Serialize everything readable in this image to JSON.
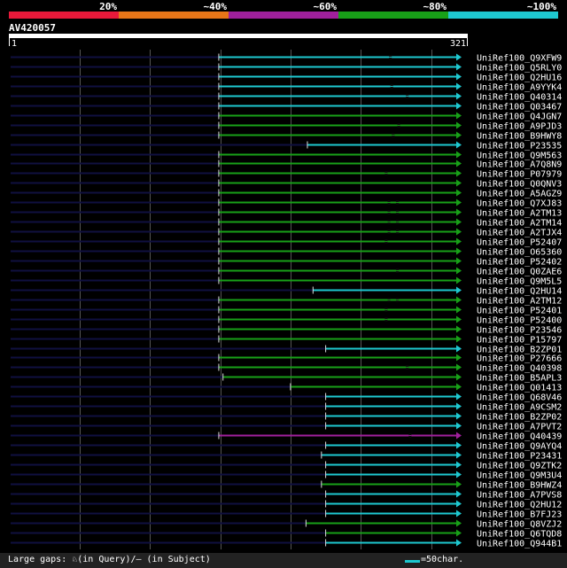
{
  "legend": {
    "labels": [
      "20%",
      "~40%",
      "~60%",
      "~80%",
      "~100%"
    ],
    "colors": [
      "#e8193a",
      "#e87618",
      "#a0209c",
      "#18a018",
      "#1ec8d0"
    ]
  },
  "query": {
    "id": "AV420057",
    "start": "1",
    "end": "321"
  },
  "footer": {
    "gaps_text": "Large gaps: ♘(in Query)/– (in Subject)",
    "scale_text": "=50char."
  },
  "chart_data": {
    "type": "alignment",
    "query_length": 321,
    "hits": [
      {
        "id": "UniRef100_Q9XFW9",
        "start": 149,
        "end": 321,
        "identity": "~100%",
        "gaps": [
          271
        ]
      },
      {
        "id": "UniRef100_Q5RLY0",
        "start": 149,
        "end": 321,
        "identity": "~100%",
        "gaps": []
      },
      {
        "id": "UniRef100_Q2HU16",
        "start": 149,
        "end": 321,
        "identity": "~100%",
        "gaps": []
      },
      {
        "id": "UniRef100_A9YYK4",
        "start": 149,
        "end": 321,
        "identity": "~100%",
        "gaps": [
          272
        ]
      },
      {
        "id": "UniRef100_Q40314",
        "start": 149,
        "end": 321,
        "identity": "~100%",
        "gaps": [
          283
        ]
      },
      {
        "id": "UniRef100_Q03467",
        "start": 149,
        "end": 321,
        "identity": "~100%",
        "gaps": []
      },
      {
        "id": "UniRef100_Q4JGN7",
        "start": 149,
        "end": 321,
        "identity": "~80%",
        "gaps": []
      },
      {
        "id": "UniRef100_A9PJD3",
        "start": 149,
        "end": 321,
        "identity": "~80%",
        "gaps": [
          277
        ]
      },
      {
        "id": "UniRef100_B9HWY8",
        "start": 149,
        "end": 321,
        "identity": "~80%",
        "gaps": [
          273
        ]
      },
      {
        "id": "UniRef100_P23535",
        "start": 212,
        "end": 321,
        "identity": "~100%",
        "gaps": []
      },
      {
        "id": "UniRef100_Q9M563",
        "start": 149,
        "end": 321,
        "identity": "~80%",
        "gaps": []
      },
      {
        "id": "UniRef100_A7Q8N9",
        "start": 149,
        "end": 321,
        "identity": "~80%",
        "gaps": []
      },
      {
        "id": "UniRef100_P07979",
        "start": 149,
        "end": 321,
        "identity": "~80%",
        "gaps": [
          268
        ]
      },
      {
        "id": "UniRef100_Q0QNV3",
        "start": 149,
        "end": 321,
        "identity": "~80%",
        "gaps": []
      },
      {
        "id": "UniRef100_A5AGZ9",
        "start": 149,
        "end": 321,
        "identity": "~80%",
        "gaps": []
      },
      {
        "id": "UniRef100_Q7XJ83",
        "start": 149,
        "end": 321,
        "identity": "~80%",
        "gaps": [
          270,
          276
        ]
      },
      {
        "id": "UniRef100_A2TM13",
        "start": 149,
        "end": 321,
        "identity": "~80%",
        "gaps": [
          270,
          276
        ]
      },
      {
        "id": "UniRef100_A2TM14",
        "start": 149,
        "end": 321,
        "identity": "~80%",
        "gaps": [
          270,
          276
        ]
      },
      {
        "id": "UniRef100_A2TJX4",
        "start": 149,
        "end": 321,
        "identity": "~80%",
        "gaps": [
          270,
          276
        ]
      },
      {
        "id": "UniRef100_P52407",
        "start": 149,
        "end": 321,
        "identity": "~80%",
        "gaps": [
          268
        ]
      },
      {
        "id": "UniRef100_O65360",
        "start": 149,
        "end": 321,
        "identity": "~80%",
        "gaps": []
      },
      {
        "id": "UniRef100_P52402",
        "start": 149,
        "end": 321,
        "identity": "~80%",
        "gaps": []
      },
      {
        "id": "UniRef100_Q0ZAE6",
        "start": 149,
        "end": 321,
        "identity": "~80%",
        "gaps": [
          276
        ]
      },
      {
        "id": "UniRef100_Q9M5L5",
        "start": 149,
        "end": 321,
        "identity": "~80%",
        "gaps": []
      },
      {
        "id": "UniRef100_Q2HU14",
        "start": 216,
        "end": 321,
        "identity": "~100%",
        "gaps": []
      },
      {
        "id": "UniRef100_A2TM12",
        "start": 149,
        "end": 321,
        "identity": "~80%",
        "gaps": [
          270,
          276
        ]
      },
      {
        "id": "UniRef100_P52401",
        "start": 149,
        "end": 321,
        "identity": "~80%",
        "gaps": [
          268
        ]
      },
      {
        "id": "UniRef100_P52400",
        "start": 149,
        "end": 321,
        "identity": "~80%",
        "gaps": [
          268
        ]
      },
      {
        "id": "UniRef100_P23546",
        "start": 149,
        "end": 321,
        "identity": "~80%",
        "gaps": []
      },
      {
        "id": "UniRef100_P15797",
        "start": 149,
        "end": 321,
        "identity": "~80%",
        "gaps": []
      },
      {
        "id": "UniRef100_B2ZP01",
        "start": 225,
        "end": 321,
        "identity": "~100%",
        "gaps": []
      },
      {
        "id": "UniRef100_P27666",
        "start": 149,
        "end": 321,
        "identity": "~80%",
        "gaps": []
      },
      {
        "id": "UniRef100_Q40398",
        "start": 149,
        "end": 321,
        "identity": "~80%",
        "gaps": [
          283
        ]
      },
      {
        "id": "UniRef100_B5APL3",
        "start": 152,
        "end": 321,
        "identity": "~80%",
        "gaps": []
      },
      {
        "id": "UniRef100_Q01413",
        "start": 200,
        "end": 321,
        "identity": "~80%",
        "gaps": []
      },
      {
        "id": "UniRef100_Q68V46",
        "start": 225,
        "end": 321,
        "identity": "~100%",
        "gaps": []
      },
      {
        "id": "UniRef100_A9CSM2",
        "start": 225,
        "end": 321,
        "identity": "~100%",
        "gaps": []
      },
      {
        "id": "UniRef100_B2ZP02",
        "start": 225,
        "end": 321,
        "identity": "~100%",
        "gaps": []
      },
      {
        "id": "UniRef100_A7PVT2",
        "start": 225,
        "end": 321,
        "identity": "~100%",
        "gaps": []
      },
      {
        "id": "UniRef100_Q40439",
        "start": 149,
        "end": 321,
        "identity": "~60%",
        "gaps": [
          285
        ]
      },
      {
        "id": "UniRef100_Q9AYQ4",
        "start": 225,
        "end": 321,
        "identity": "~100%",
        "gaps": []
      },
      {
        "id": "UniRef100_P23431",
        "start": 222,
        "end": 321,
        "identity": "~100%",
        "gaps": []
      },
      {
        "id": "UniRef100_Q9ZTK2",
        "start": 225,
        "end": 321,
        "identity": "~100%",
        "gaps": []
      },
      {
        "id": "UniRef100_Q9M3U4",
        "start": 225,
        "end": 321,
        "identity": "~100%",
        "gaps": []
      },
      {
        "id": "UniRef100_B9HWZ4",
        "start": 222,
        "end": 321,
        "identity": "~80%",
        "gaps": []
      },
      {
        "id": "UniRef100_A7PVS8",
        "start": 225,
        "end": 321,
        "identity": "~100%",
        "gaps": []
      },
      {
        "id": "UniRef100_Q2HU12",
        "start": 225,
        "end": 321,
        "identity": "~100%",
        "gaps": []
      },
      {
        "id": "UniRef100_B7FJ23",
        "start": 225,
        "end": 321,
        "identity": "~100%",
        "gaps": []
      },
      {
        "id": "UniRef100_Q8VZJ2",
        "start": 211,
        "end": 321,
        "identity": "~80%",
        "gaps": []
      },
      {
        "id": "UniRef100_Q6TQD8",
        "start": 225,
        "end": 321,
        "identity": "~80%",
        "gaps": []
      },
      {
        "id": "UniRef100_Q944B1",
        "start": 225,
        "end": 321,
        "identity": "~100%",
        "gaps": []
      }
    ]
  }
}
